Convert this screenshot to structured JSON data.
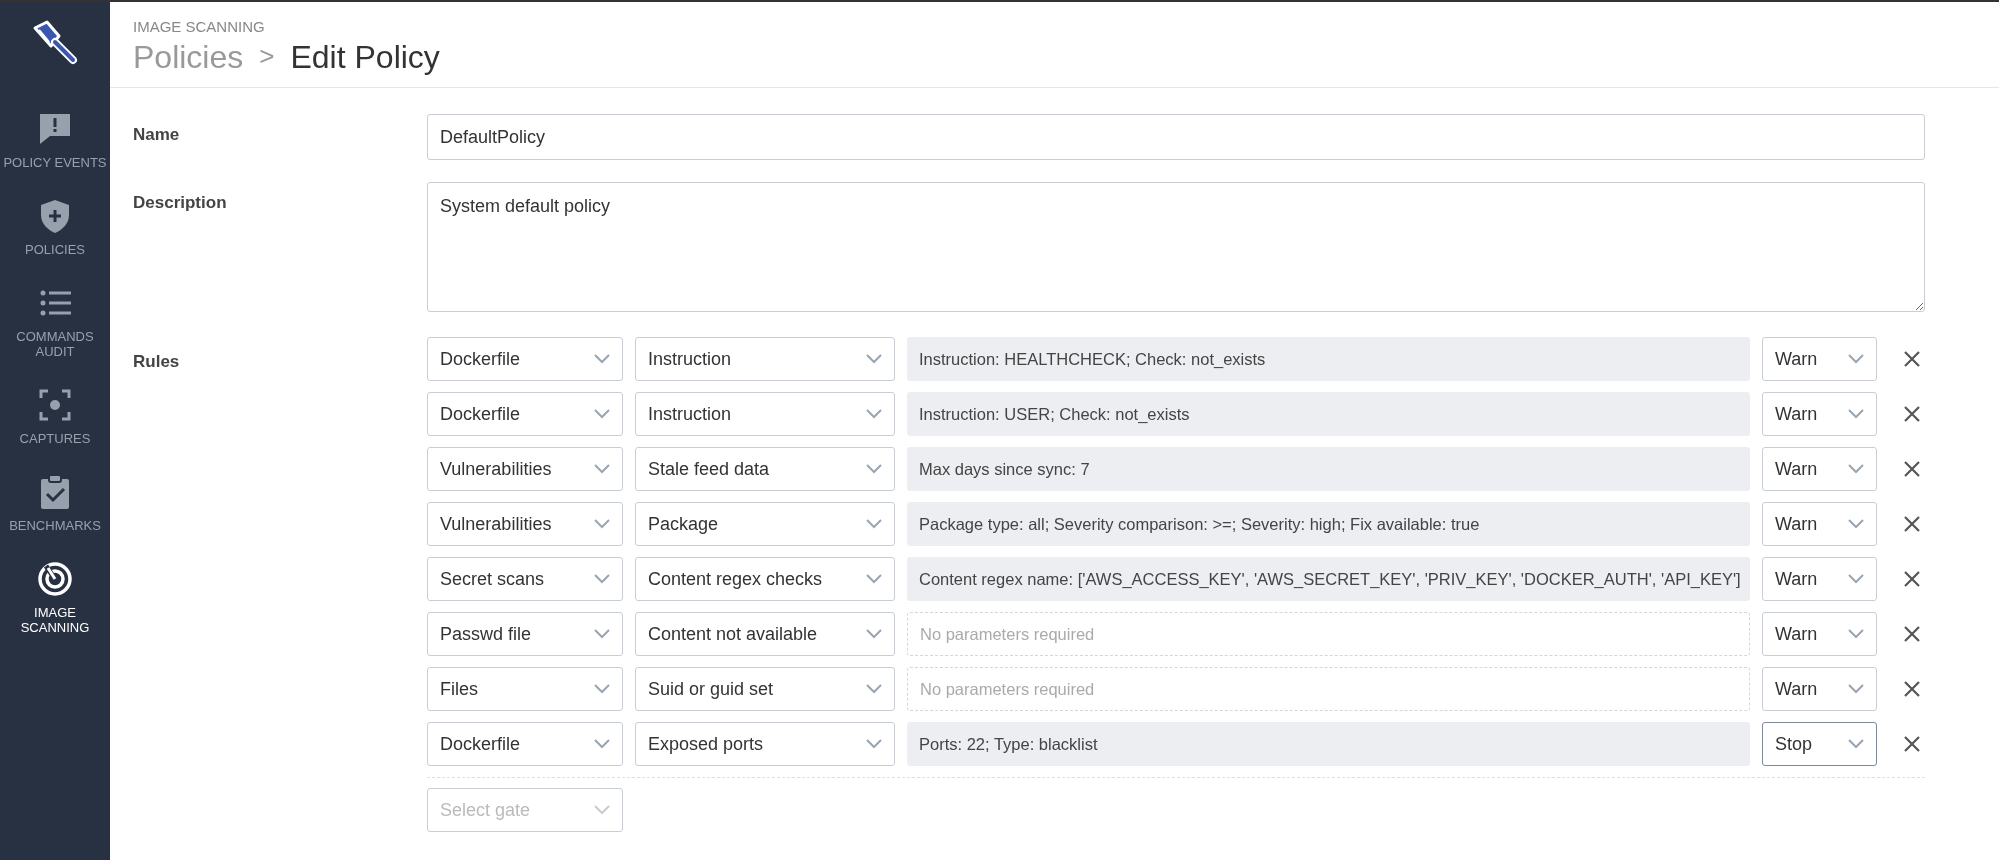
{
  "sidebar": {
    "items": [
      {
        "label": "POLICY EVENTS",
        "kind": "alert",
        "selected": false
      },
      {
        "label": "POLICIES",
        "kind": "shield",
        "selected": false
      },
      {
        "label": "COMMANDS AUDIT",
        "kind": "list",
        "selected": false
      },
      {
        "label": "CAPTURES",
        "kind": "capture",
        "selected": false
      },
      {
        "label": "BENCHMARKS",
        "kind": "clipboard",
        "selected": false
      },
      {
        "label": "IMAGE SCANNING",
        "kind": "radar",
        "selected": true
      }
    ]
  },
  "header": {
    "section": "IMAGE SCANNING",
    "breadcrumb": [
      {
        "label": "Policies",
        "current": false
      },
      {
        "label": "Edit Policy",
        "current": true
      }
    ],
    "separator": ">"
  },
  "form": {
    "name_label": "Name",
    "name_value": "DefaultPolicy",
    "description_label": "Description",
    "description_value": "System default policy",
    "rules_label": "Rules",
    "rules": [
      {
        "gate": "Dockerfile",
        "trigger": "Instruction",
        "params": "Instruction: HEALTHCHECK; Check: not_exists",
        "action": "Warn",
        "focused": false
      },
      {
        "gate": "Dockerfile",
        "trigger": "Instruction",
        "params": "Instruction: USER; Check: not_exists",
        "action": "Warn",
        "focused": false
      },
      {
        "gate": "Vulnerabilities",
        "trigger": "Stale feed data",
        "params": "Max days since sync: 7",
        "action": "Warn",
        "focused": false
      },
      {
        "gate": "Vulnerabilities",
        "trigger": "Package",
        "params": "Package type: all; Severity comparison: >=; Severity: high; Fix available: true",
        "action": "Warn",
        "focused": false
      },
      {
        "gate": "Secret scans",
        "trigger": "Content regex checks",
        "params": "Content regex name: ['AWS_ACCESS_KEY', 'AWS_SECRET_KEY', 'PRIV_KEY', 'DOCKER_AUTH', 'API_KEY']",
        "action": "Warn",
        "focused": false
      },
      {
        "gate": "Passwd file",
        "trigger": "Content not available",
        "placeholder": "No parameters required",
        "action": "Warn",
        "focused": false
      },
      {
        "gate": "Files",
        "trigger": "Suid or guid set",
        "placeholder": "No parameters required",
        "action": "Warn",
        "focused": false
      },
      {
        "gate": "Dockerfile",
        "trigger": "Exposed ports",
        "params": "Ports: 22; Type: blacklist",
        "action": "Stop",
        "focused": true
      }
    ],
    "new_rule": {
      "placeholder": "Select gate"
    }
  }
}
